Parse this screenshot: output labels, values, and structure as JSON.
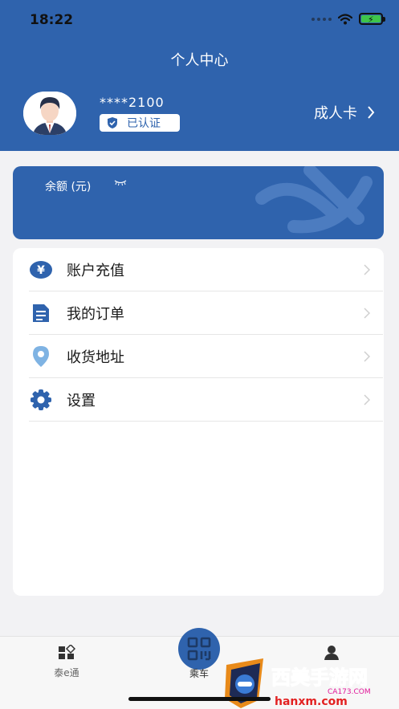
{
  "status_bar": {
    "time": "18:22"
  },
  "page": {
    "title": "个人中心"
  },
  "profile": {
    "phone_masked": "****2100",
    "cert_label": "已认证",
    "card_type": "成人卡"
  },
  "balance": {
    "label": "余额 (元)"
  },
  "menu": [
    {
      "label": "账户充值",
      "icon": "yen-icon"
    },
    {
      "label": "我的订单",
      "icon": "document-icon"
    },
    {
      "label": "收货地址",
      "icon": "location-pin-icon"
    },
    {
      "label": "设置",
      "icon": "gear-icon"
    }
  ],
  "tabbar": {
    "home_label": "泰e通",
    "ride_label": "乘车",
    "mine_label": ""
  },
  "watermark": {
    "text_cn": "西美手游网",
    "text_site": "hanxm.com",
    "text_small": "CA173.COM"
  },
  "colors": {
    "brand": "#2f63ad",
    "background": "#f2f2f4"
  }
}
